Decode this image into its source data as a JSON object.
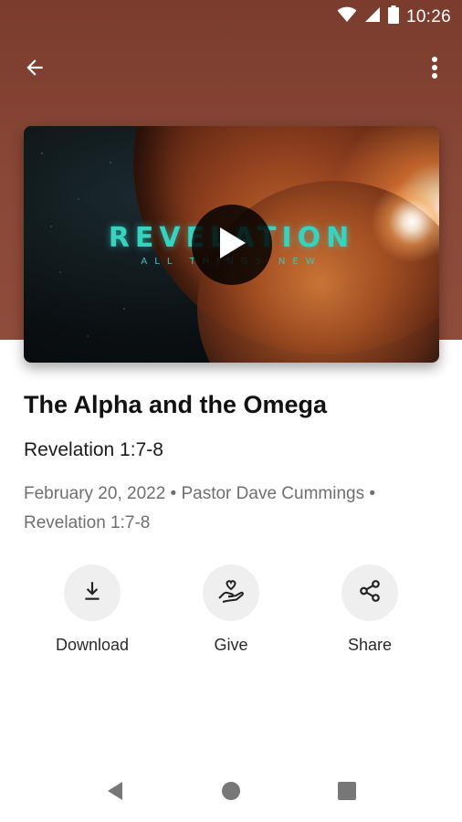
{
  "status_bar": {
    "time": "10:26",
    "icons": [
      "wifi-icon",
      "signal-icon",
      "battery-icon"
    ]
  },
  "toolbar": {
    "back_icon": "arrow-back-icon",
    "more_icon": "more-vert-icon"
  },
  "video": {
    "title_art": "REVELATION",
    "subtitle_art": "ALL THINGS NEW",
    "play_icon": "play-icon"
  },
  "sermon": {
    "title": "The Alpha and the Omega",
    "passage": "Revelation 1:7-8",
    "meta_line1": "February 20, 2022 • Pastor Dave Cummings •",
    "meta_line2": "Revelation 1:7-8"
  },
  "actions": [
    {
      "label": "Download",
      "icon": "download-icon"
    },
    {
      "label": "Give",
      "icon": "give-hand-heart-icon"
    },
    {
      "label": "Share",
      "icon": "share-icon"
    }
  ],
  "nav": {
    "back": "nav-back-icon",
    "home": "nav-home-icon",
    "recents": "nav-recents-icon"
  },
  "colors": {
    "header": "#8a4838",
    "accent_teal": "#39d2c0",
    "action_bg": "#efefef",
    "meta_text": "#6f6f6f"
  }
}
